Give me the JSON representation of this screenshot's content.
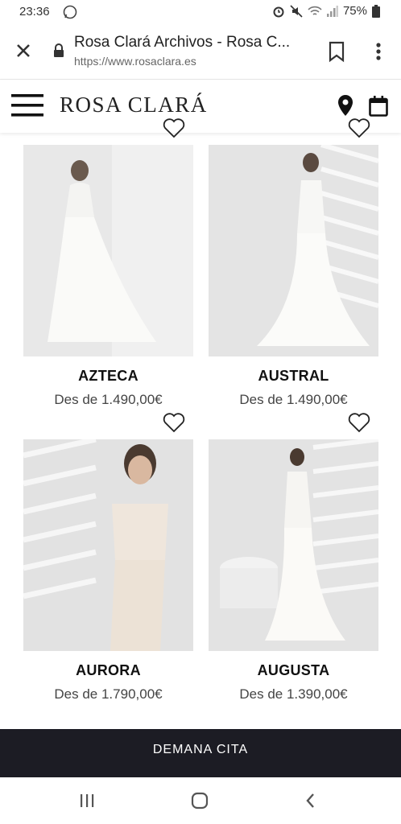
{
  "status": {
    "time": "23:36",
    "battery": "75%"
  },
  "browser": {
    "tab_title": "Rosa Clará Archivos - Rosa C...",
    "url": "https://www.rosaclara.es"
  },
  "site": {
    "logo": "ROSA CLARÁ"
  },
  "products": [
    {
      "name": "AZTECA",
      "price": "Des de 1.490,00€"
    },
    {
      "name": "AUSTRAL",
      "price": "Des de 1.490,00€"
    },
    {
      "name": "AURORA",
      "price": "Des de 1.790,00€"
    },
    {
      "name": "AUGUSTA",
      "price": "Des de 1.390,00€"
    }
  ],
  "cta": {
    "label": "DEMANA CITA"
  },
  "colors": {
    "cta_bg": "#1c1c24",
    "text": "#222222"
  },
  "icons": [
    "whatsapp-icon",
    "alarm-icon",
    "mute-icon",
    "wifi-icon",
    "signal-icon",
    "battery-icon",
    "close-icon",
    "lock-icon",
    "bookmark-icon",
    "more-icon",
    "menu-icon",
    "location-pin-icon",
    "calendar-icon",
    "heart-icon",
    "recents-icon",
    "home-icon",
    "back-icon"
  ]
}
